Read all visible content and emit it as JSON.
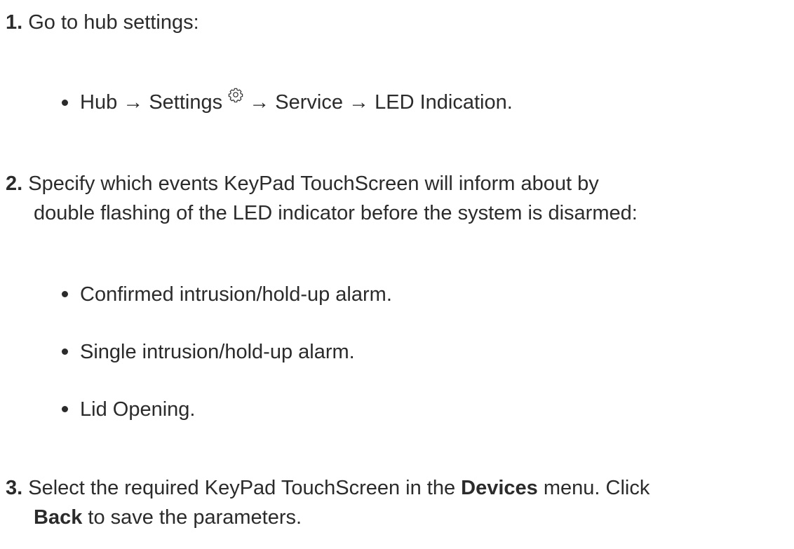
{
  "steps": [
    {
      "number": "1.",
      "text": "Go to hub settings:",
      "bullets": [
        {
          "parts": {
            "a": "Hub → Settings",
            "icon": "gear-icon",
            "b": "→ Service → LED Indication."
          }
        }
      ]
    },
    {
      "number": "2.",
      "line1": "Specify which events KeyPad TouchScreen will inform about by",
      "line2": "double flashing of the LED indicator before the system is disarmed:",
      "bullets": [
        {
          "text": "Confirmed intrusion/hold-up alarm."
        },
        {
          "text": "Single intrusion/hold-up alarm."
        },
        {
          "text": "Lid Opening."
        }
      ]
    },
    {
      "number": "3.",
      "line1_a": "Select the required KeyPad TouchScreen in the ",
      "line1_bold": "Devices",
      "line1_b": " menu. Click",
      "line2_bold": "Back",
      "line2_b": " to save the parameters."
    }
  ]
}
